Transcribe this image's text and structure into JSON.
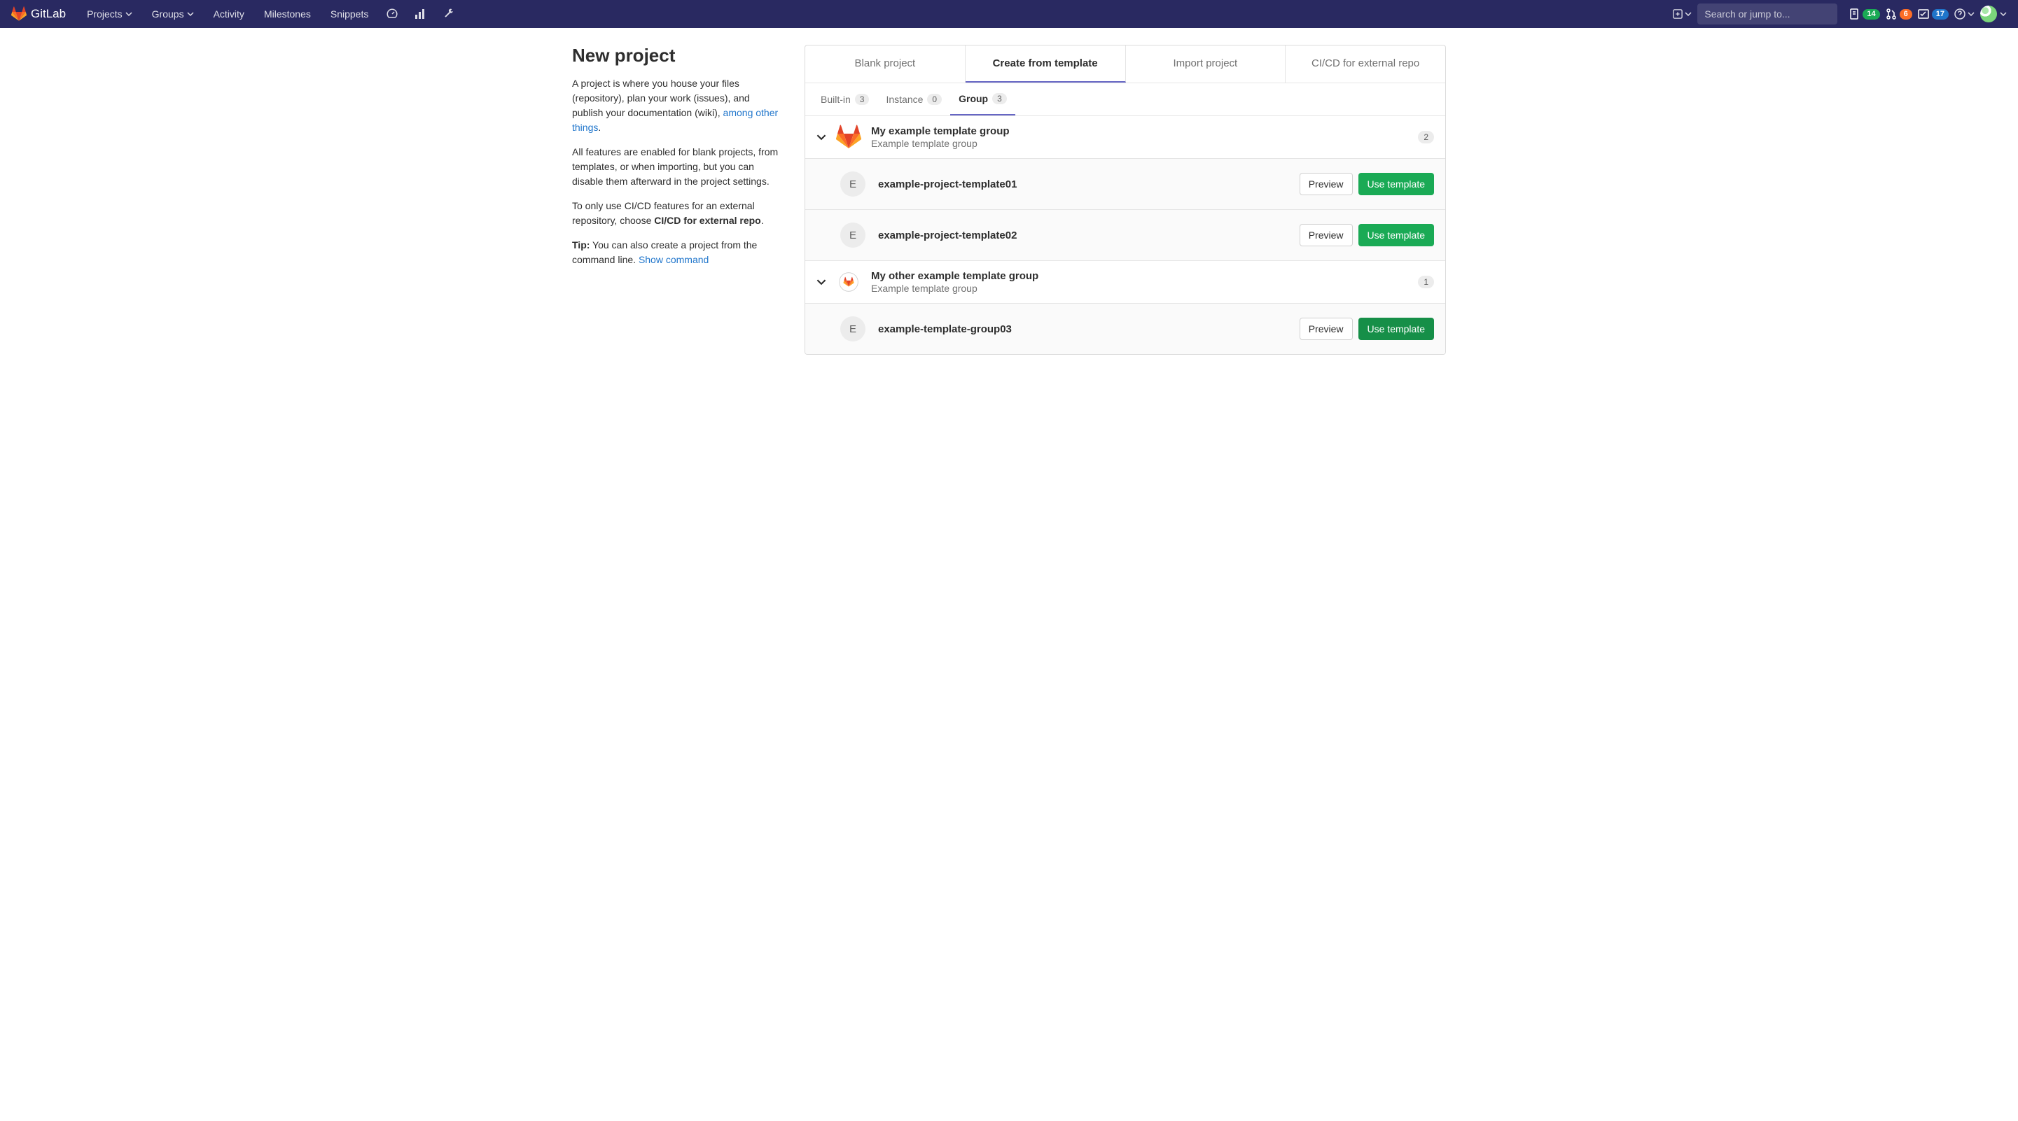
{
  "brand": "GitLab",
  "nav": {
    "projects": "Projects",
    "groups": "Groups",
    "activity": "Activity",
    "milestones": "Milestones",
    "snippets": "Snippets"
  },
  "search": {
    "placeholder": "Search or jump to..."
  },
  "counters": {
    "issues": "14",
    "mrs": "6",
    "todos": "17"
  },
  "side": {
    "title": "New project",
    "p1a": "A project is where you house your files (repository), plan your work (issues), and publish your documentation (wiki), ",
    "p1link": "among other things",
    "p1b": ".",
    "p2": "All features are enabled for blank projects, from templates, or when importing, but you can disable them afterward in the project settings.",
    "p3a": "To only use CI/CD features for an external repository, choose ",
    "p3b": "CI/CD for external repo",
    "p3c": ".",
    "p4a": "Tip:",
    "p4b": " You can also create a project from the command line. ",
    "p4link": "Show command"
  },
  "tabs": {
    "blank": "Blank project",
    "template": "Create from template",
    "import": "Import project",
    "cicd": "CI/CD for external repo"
  },
  "subtabs": {
    "builtin": "Built-in",
    "builtin_n": "3",
    "instance": "Instance",
    "instance_n": "0",
    "group": "Group",
    "group_n": "3"
  },
  "buttons": {
    "preview": "Preview",
    "use": "Use template"
  },
  "groups": [
    {
      "name": "My example template group",
      "desc": "Example template group",
      "count": "2",
      "avatar": "gitlab",
      "items": [
        {
          "letter": "E",
          "name": "example-project-template01"
        },
        {
          "letter": "E",
          "name": "example-project-template02"
        }
      ]
    },
    {
      "name": "My other example template group",
      "desc": "Example template group",
      "count": "1",
      "avatar": "tanuki-ring",
      "items": [
        {
          "letter": "E",
          "name": "example-template-group03"
        }
      ]
    }
  ]
}
